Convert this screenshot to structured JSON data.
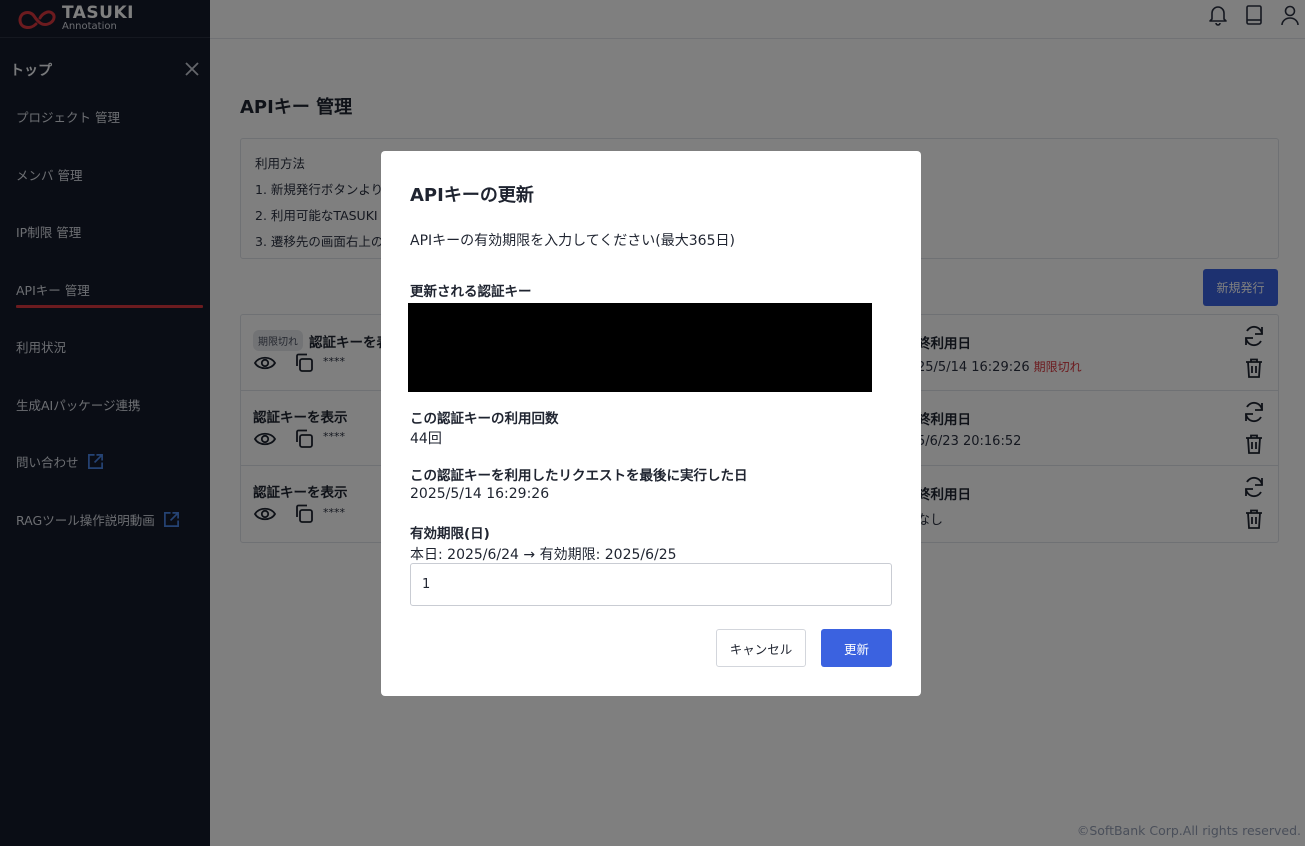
{
  "app": {
    "logo_title": "TASUKI",
    "logo_subtitle": "Annotation"
  },
  "sidebar": {
    "top_label": "トップ",
    "items": [
      {
        "label": "プロジェクト 管理"
      },
      {
        "label": "メンバ 管理"
      },
      {
        "label": "IP制限 管理"
      },
      {
        "label": "APIキー 管理",
        "active": true
      },
      {
        "label": "利用状況"
      },
      {
        "label": "生成AIパッケージ連携"
      },
      {
        "label": "問い合わせ",
        "external": true
      },
      {
        "label": "RAGツール操作説明動画",
        "external": true
      }
    ]
  },
  "header": {
    "icons": [
      "bell-icon",
      "book-icon",
      "user-icon"
    ]
  },
  "main": {
    "page_title": "APIキー 管理",
    "usage": {
      "heading": "利用方法",
      "steps": [
        "1. 新規発行ボタンより",
        "2. 利用可能なTASUKI",
        "3. 遷移先の画面右上の"
      ]
    },
    "new_button": "新規発行",
    "keys": [
      {
        "badge": "期限切れ",
        "label": "認証キーを表",
        "masked": "****",
        "last_used_label": "終利用日",
        "last_used_value": "25/5/14 16:29:26",
        "status": "期限切れ"
      },
      {
        "badge": "",
        "label": "認証キーを表示",
        "masked": "****",
        "last_used_label": "終利用日",
        "last_used_value": "5/6/23 20:16:52",
        "status": ""
      },
      {
        "badge": "",
        "label": "認証キーを表示",
        "masked": "****",
        "last_used_label": "終利用日",
        "last_used_value": "なし",
        "status": ""
      }
    ]
  },
  "modal": {
    "title": "APIキーの更新",
    "description": "APIキーの有効期限を入力してください(最大365日)",
    "key_label": "更新される認証キー",
    "usage_count_label": "この認証キーの利用回数",
    "usage_count_value": "44回",
    "last_request_label": "この認証キーを利用したリクエストを最後に実行した日",
    "last_request_value": "2025/5/14 16:29:26",
    "days_label": "有効期限(日)",
    "dates_text": "本日: 2025/6/24 → 有効期限: 2025/6/25",
    "days_value": "1",
    "cancel_label": "キャンセル",
    "update_label": "更新"
  },
  "footer": {
    "copyright": "©SoftBank Corp.All rights reserved."
  },
  "colors": {
    "sidebar_bg": "#141a2a",
    "accent_red": "#d9363e",
    "primary_blue": "#3b62e0"
  }
}
